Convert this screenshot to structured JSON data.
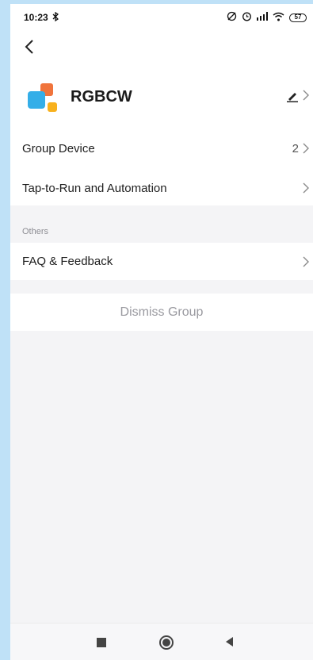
{
  "status_bar": {
    "time": "10:23",
    "bluetooth_icon": "bluetooth-icon",
    "status_icons": "✕⏰ ::! ≋",
    "battery": "57"
  },
  "nav": {
    "back_icon": "back-arrow-icon"
  },
  "group": {
    "name": "RGBCW",
    "logo_colors": [
      "#f0743c",
      "#34aee8",
      "#f8b11d"
    ]
  },
  "rows": {
    "group_device": {
      "label": "Group Device",
      "value": "2"
    },
    "tap_to_run": {
      "label": "Tap-to-Run and Automation"
    },
    "faq": {
      "label": "FAQ & Feedback"
    }
  },
  "section": {
    "others": "Others"
  },
  "actions": {
    "dismiss": "Dismiss Group"
  },
  "colors": {
    "background": "#f4f4f6",
    "muted_text": "#9a9aa0"
  }
}
